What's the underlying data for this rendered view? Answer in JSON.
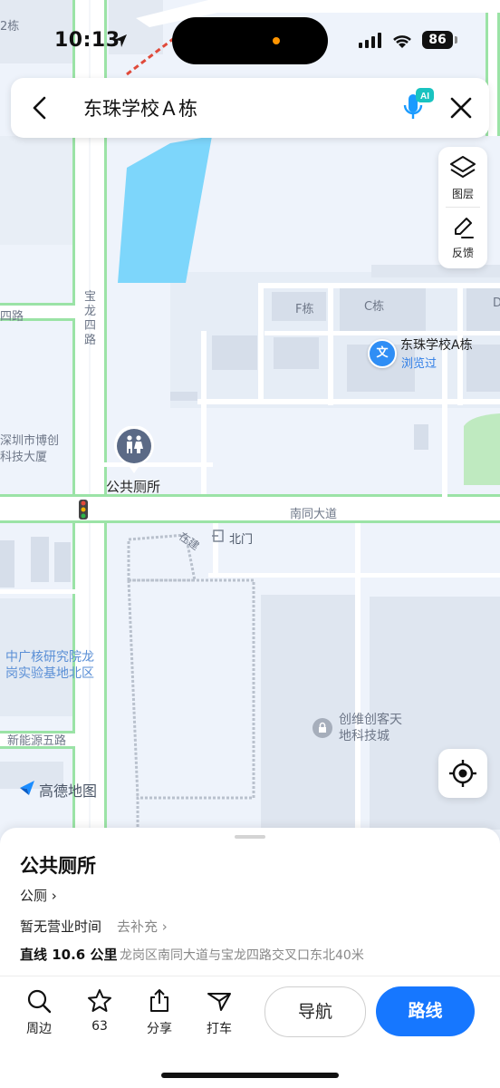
{
  "status_bar": {
    "time": "10:13",
    "battery": "86"
  },
  "search": {
    "query": "东珠学校Ａ栋"
  },
  "tools": {
    "layers_label": "图层",
    "feedback_label": "反馈"
  },
  "map": {
    "labels": {
      "top_left_fragment": "2栋",
      "baolong_road": "宝龙四路",
      "left_road": "四路",
      "shenzhen_expo": "深圳市博创科技大厦",
      "toilet": "公共厕所",
      "f_building": "F栋",
      "c_building": "C栋",
      "d_fragment": "D",
      "school_name": "东珠学校A栋",
      "browsed": "浏览过",
      "nantong_road": "南同大道",
      "north_gate": "北门",
      "under_construction": "在建",
      "cgn_base": "中广核研究院龙岗实验基地北区",
      "xinnengyuan_road": "新能源五路",
      "chuangwei": "创维创客天地科技城",
      "brand": "高德地图"
    },
    "colors": {
      "water": "#7dd6fb",
      "road_edge": "#9be3a6",
      "road": "#ffffff",
      "block": "#dfe6f0"
    }
  },
  "poi": {
    "title": "公共厕所",
    "category": "公厕 ›",
    "hours": "暂无营业时间",
    "hours_action": "去补充 ›",
    "distance": "直线 10.6 公里",
    "address": "龙岗区南同大道与宝龙四路交叉口东北40米"
  },
  "actions": {
    "nearby": "周边",
    "favorites": "63",
    "share": "分享",
    "taxi": "打车",
    "navigate": "导航",
    "route": "路线"
  }
}
